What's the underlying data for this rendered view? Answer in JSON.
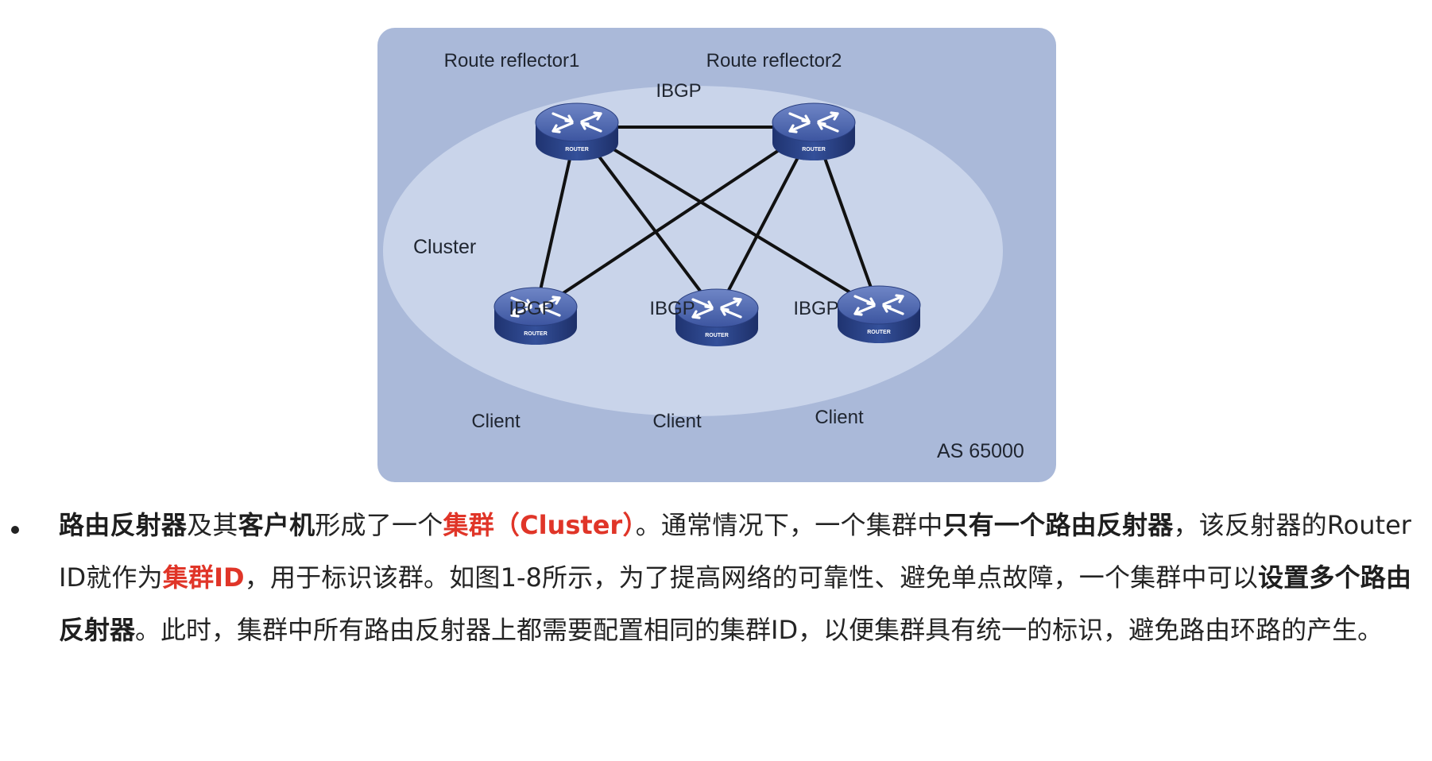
{
  "diagram": {
    "routers": [
      {
        "id": "rr1",
        "label": "Route reflector1",
        "badge": "ROUTER"
      },
      {
        "id": "rr2",
        "label": "Route reflector2",
        "badge": "ROUTER"
      },
      {
        "id": "c1",
        "label": "Client",
        "badge": "ROUTER"
      },
      {
        "id": "c2",
        "label": "Client",
        "badge": "ROUTER"
      },
      {
        "id": "c3",
        "label": "Client",
        "badge": "ROUTER"
      }
    ],
    "links": [
      {
        "from": "rr1",
        "to": "rr2",
        "label": "IBGP"
      },
      {
        "from": "rr1",
        "to": "c1",
        "label": "IBGP"
      },
      {
        "from": "rr1",
        "to": "c2",
        "label": ""
      },
      {
        "from": "rr1",
        "to": "c3",
        "label": ""
      },
      {
        "from": "rr2",
        "to": "c1",
        "label": ""
      },
      {
        "from": "rr2",
        "to": "c2",
        "label": "IBGP"
      },
      {
        "from": "rr2",
        "to": "c3",
        "label": "IBGP"
      }
    ],
    "cluster_label": "Cluster",
    "as_label": "AS 65000",
    "colors": {
      "panel": "#aab9d9",
      "cluster": "#c9d4ea",
      "router_top": "#4a62a8",
      "router_body": "#2c4280",
      "link": "#111111"
    }
  },
  "article": {
    "segments": [
      {
        "text": "路由反射器",
        "style": "strong"
      },
      {
        "text": "及其",
        "style": "normal"
      },
      {
        "text": "客户机",
        "style": "strong"
      },
      {
        "text": "形成了一个",
        "style": "normal"
      },
      {
        "text": "集群（Cluster）",
        "style": "red"
      },
      {
        "text": "。通常情况下，一个集群中",
        "style": "normal"
      },
      {
        "text": "只有一个路由反射器",
        "style": "strong"
      },
      {
        "text": "，该反射器的Router ID就作为",
        "style": "normal"
      },
      {
        "text": "集群ID",
        "style": "red"
      },
      {
        "text": "，用于标识该群。如图1-8所示，为了提高网络的可靠性、避免单点故障，一个集群中可以",
        "style": "normal"
      },
      {
        "text": "设置多个路由反射器",
        "style": "strong"
      },
      {
        "text": "。此时，集群中所有路由反射器上都需要配置相同的集群ID，以便集群具有统一的标识，避免路由环路的产生。",
        "style": "normal"
      }
    ],
    "colors": {
      "text": "#242424",
      "highlight": "#e03528"
    }
  }
}
